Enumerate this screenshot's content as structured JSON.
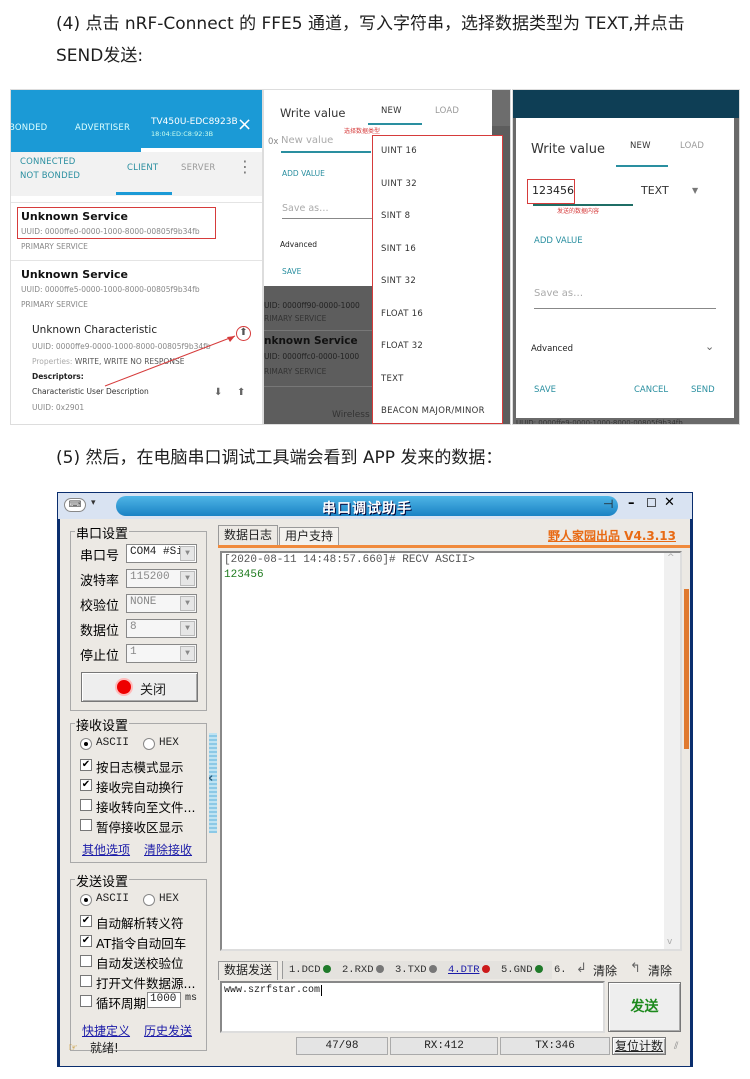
{
  "step4": {
    "line1": "(4) 点击 nRF-Connect 的 FFE5 通道，写入字符串，选择数据类型为 TEXT,并点击",
    "line2": "SEND发送:"
  },
  "step5": {
    "line1": "(5) 然后，在电脑串口调试工具端会看到 APP 发来的数据："
  },
  "phone1": {
    "tabs": [
      "BONDED",
      "ADVERTISER"
    ],
    "device_name": "TV450U-EDC8923B",
    "device_mac": "18:04:ED:C8:92:3B",
    "close_icon": "×",
    "conn_status": "CONNECTED",
    "bond_status": "NOT BONDED",
    "client_tab": "CLIENT",
    "server_tab": "SERVER",
    "more_icon": "⋮",
    "services": [
      {
        "name": "Unknown Service",
        "uuid": "UUID: 0000ffe0-0000-1000-8000-00805f9b34fb",
        "type": "PRIMARY SERVICE"
      },
      {
        "name": "Unknown Service",
        "uuid": "UUID: 0000ffe5-0000-1000-8000-00805f9b34fb",
        "type": "PRIMARY SERVICE"
      }
    ],
    "characteristic": {
      "name": "Unknown Characteristic",
      "uuid": "UUID: 0000ffe9-0000-1000-8000-00805f9b34fb",
      "properties_label": "Properties: ",
      "properties": "WRITE, WRITE NO RESPONSE",
      "descriptors_label": "Descriptors:",
      "descriptor_name": "Characteristic User Description",
      "descriptor_uuid": "UUID: 0x2901"
    }
  },
  "phone2": {
    "title": "Write value",
    "tab_new": "NEW",
    "tab_load": "LOAD",
    "annotation": "选择数据类型",
    "prefix": "0x",
    "placeholder": "New value",
    "add_value": "ADD VALUE",
    "save_as": "Save as…",
    "advanced": "Advanced",
    "save": "SAVE",
    "bg_uuid": "UID: 0000ff90-0000-1000",
    "bg_primary": "RIMARY SERVICE",
    "bg_service": "nknown Service",
    "bg_uuid2": "UID: 0000ffc0-0000-1000",
    "bg_primary2": "RIMARY SERVICE",
    "bg_wireless": "Wireless",
    "type_options": [
      "UINT 16",
      "UINT 32",
      "SINT 8",
      "SINT 16",
      "SINT 32",
      "FLOAT 16",
      "FLOAT 32",
      "TEXT",
      "BEACON MAJOR/MINOR"
    ]
  },
  "phone3": {
    "title": "Write value",
    "tab_new": "NEW",
    "tab_load": "LOAD",
    "value": "123456",
    "type": "TEXT",
    "annotation": "发送的数据内容",
    "add_value": "ADD VALUE",
    "save_as": "Save as…",
    "advanced": "Advanced",
    "save": "SAVE",
    "cancel": "CANCEL",
    "send": "SEND",
    "bg_uuid": "UUID: 0000ffe9-0000-1000-8000-00805f9b34fb"
  },
  "serial": {
    "title": "串口调试助手",
    "brand": "野人家园出品 V4.3.13",
    "port_group": "串口设置",
    "port_label": "串口号",
    "port_value": "COM4 #Si]",
    "baud_label": "波特率",
    "baud_value": "115200",
    "parity_label": "校验位",
    "parity_value": "NONE",
    "data_label": "数据位",
    "data_value": "8",
    "stop_label": "停止位",
    "stop_value": "1",
    "close_btn": "关闭",
    "recv_group": "接收设置",
    "recv_ascii": "ASCII",
    "recv_hex": "HEX",
    "recv_opts": [
      {
        "label": "按日志模式显示",
        "checked": true
      },
      {
        "label": "接收完自动换行",
        "checked": true
      },
      {
        "label": "接收转向至文件...",
        "checked": false
      },
      {
        "label": "暂停接收区显示",
        "checked": false
      }
    ],
    "recv_links": [
      "其他选项",
      "清除接收"
    ],
    "send_group": "发送设置",
    "send_ascii": "ASCII",
    "send_hex": "HEX",
    "send_opts": [
      {
        "label": "自动解析转义符",
        "checked": true
      },
      {
        "label": "AT指令自动回车",
        "checked": true
      },
      {
        "label": "自动发送校验位",
        "checked": false
      },
      {
        "label": "打开文件数据源...",
        "checked": false
      },
      {
        "label": "循环周期",
        "checked": false
      }
    ],
    "period_value": "1000",
    "period_unit": "ms",
    "send_links": [
      "快捷定义",
      "历史发送"
    ],
    "tabs": [
      "数据日志",
      "用户支持"
    ],
    "log_header": "[2020-08-11 14:48:57.660]# RECV ASCII>",
    "log_data": "123456",
    "send_tab": "数据发送",
    "pins": [
      {
        "label": "1.DCD",
        "color": "#1f7a2a"
      },
      {
        "label": "2.RXD",
        "color": "#777777"
      },
      {
        "label": "3.TXD",
        "color": "#777777"
      },
      {
        "label": "4.DTR",
        "color": "#cc1a1a"
      },
      {
        "label": "5.GND",
        "color": "#1f7a2a"
      },
      {
        "label": "6.",
        "color": ""
      }
    ],
    "clear1": "清除",
    "clear2": "清除",
    "send_input": "www.szrfstar.com",
    "send_btn": "发送",
    "status": "就绪!",
    "count": "47/98",
    "rx": "RX:412",
    "tx": "TX:346",
    "reset_btn": "复位计数"
  }
}
